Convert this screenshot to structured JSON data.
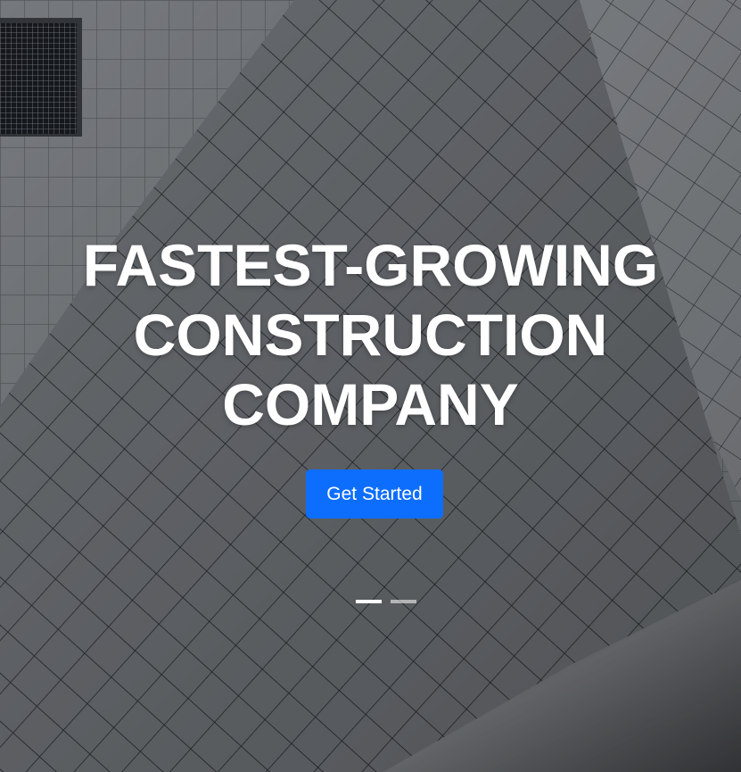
{
  "hero": {
    "headline_lines": [
      "FASTEST-GROWING",
      "CONSTRUCTION",
      "COMPANY"
    ],
    "cta_label": "Get Started",
    "slides": {
      "total": 2,
      "active_index": 0
    }
  },
  "colors": {
    "cta_background": "#0d6efd",
    "headline_text": "#ffffff",
    "facade_gray": "#6f7378",
    "grid_line": "#1f2327"
  }
}
